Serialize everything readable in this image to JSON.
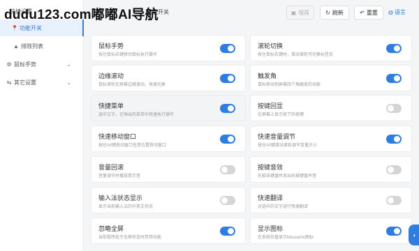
{
  "watermark": "dudu123.com嘟嘟AI导航",
  "page_title": "功能开关",
  "sidebar": {
    "header": "快捷设置",
    "items": [
      {
        "label": "功能开关",
        "icon": "pin-icon",
        "active": true
      },
      {
        "label": "排除列表",
        "icon": "triangle-icon"
      },
      {
        "label": "鼠标手势",
        "icon": "gear-icon",
        "expand": "chevron-down-icon"
      },
      {
        "label": "其它设置",
        "icon": "sliders-icon",
        "expand": "chevron-down-icon"
      }
    ]
  },
  "toolbar": {
    "save": {
      "label": "保存",
      "icon": "save-icon"
    },
    "refresh": {
      "label": "刷新",
      "icon": "refresh-icon"
    },
    "reset": {
      "label": "重置",
      "icon": "undo-icon"
    },
    "lang": {
      "label": "语言",
      "icon": "globe-icon"
    }
  },
  "features": [
    {
      "title": "鼠标手势",
      "desc": "按住鼠标右键移动鼠标执行操作",
      "on": true
    },
    {
      "title": "滚轮切换",
      "desc": "按住鼠标右键时，滚动滚轮可切换标签页",
      "on": true
    },
    {
      "title": "边缘滚动",
      "desc": "鼠标滚轮在屏幕边缘滚动，快速切换",
      "on": true
    },
    {
      "title": "触发角",
      "desc": "鼠标移动到屏幕四个角触发的功能",
      "on": true
    },
    {
      "title": "快捷菜单",
      "desc": "选中文字，在弹出的菜单中快速执行操作",
      "on": true
    },
    {
      "title": "按键回显",
      "desc": "在屏幕上显示按下的按键",
      "on": false
    },
    {
      "title": "快速移动窗口",
      "desc": "按住Alt键拖动窗口任意位置移动窗口",
      "on": true
    },
    {
      "title": "快速音量调节",
      "desc": "按住Alt键滚动滚轮调节音量大小",
      "on": true
    },
    {
      "title": "音量回滚",
      "desc": "音量调节时播放提示音",
      "on": false
    },
    {
      "title": "按键音效",
      "desc": "在敲击键盘时发出机械键盘声音",
      "on": false
    },
    {
      "title": "输入法状态显示",
      "desc": "显示当前输入法的中英文状态",
      "on": false
    },
    {
      "title": "快速翻译",
      "desc": "对选中的文字进行快速翻译",
      "on": false
    },
    {
      "title": "忽略全屏",
      "desc": "当前程序处于全屏状态时禁用功能",
      "on": true
    },
    {
      "title": "显示图标",
      "desc": "在系统托盘显示MouseInc图标",
      "on": true
    }
  ],
  "float_button": {
    "icon": "toggle-icon"
  },
  "colors": {
    "accent": "#2f7de1",
    "toggle_off": "#d5d5d5",
    "sidebar_active_bg": "#e8f1fc"
  }
}
